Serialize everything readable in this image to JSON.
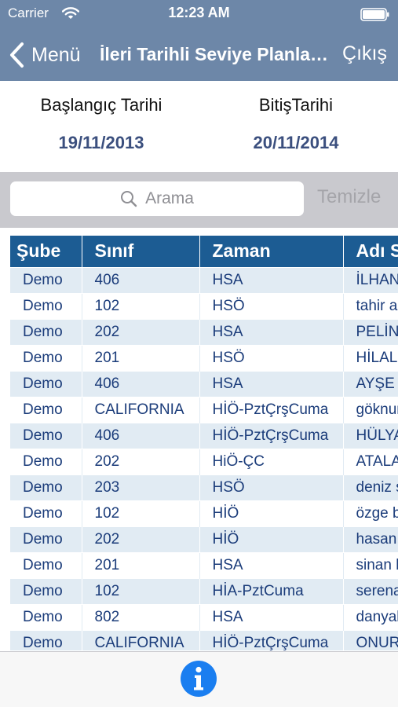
{
  "status_bar": {
    "carrier": "Carrier",
    "time": "12:23 AM"
  },
  "nav": {
    "back_label": "Menü",
    "title": "İleri Tarihli Seviye Planlaması",
    "exit_label": "Çıkış"
  },
  "dates": {
    "start_label": "Başlangıç Tarihi",
    "start_value": "19/11/2013",
    "end_label": "BitişTarihi",
    "end_value": "20/11/2014"
  },
  "search": {
    "placeholder": "Arama",
    "clear_label": "Temizle"
  },
  "table": {
    "headers": [
      "Şube",
      "Sınıf",
      "Zaman",
      "Adı Soyadı"
    ],
    "rows": [
      [
        "Demo",
        "406",
        "HSA",
        "İLHAN"
      ],
      [
        "Demo",
        "102",
        "HSÖ",
        "tahir a"
      ],
      [
        "Demo",
        "202",
        "HSA",
        "PELİN"
      ],
      [
        "Demo",
        "201",
        "HSÖ",
        "HİLAL"
      ],
      [
        "Demo",
        "406",
        "HSA",
        "AYŞE"
      ],
      [
        "Demo",
        "CALIFORNIA",
        "HİÖ-PztÇrşCuma",
        "göknur"
      ],
      [
        "Demo",
        "406",
        "HİÖ-PztÇrşCuma",
        "HÜLYA"
      ],
      [
        "Demo",
        "202",
        "HiÖ-ÇC",
        "ATALA"
      ],
      [
        "Demo",
        "203",
        "HSÖ",
        "deniz s"
      ],
      [
        "Demo",
        "102",
        "HİÖ",
        "özge b"
      ],
      [
        "Demo",
        "202",
        "HİÖ",
        "hasan"
      ],
      [
        "Demo",
        "201",
        "HSA",
        "sinan b"
      ],
      [
        "Demo",
        "102",
        "HİA-PztCuma",
        "serena"
      ],
      [
        "Demo",
        "802",
        "HSA",
        "danyal"
      ],
      [
        "Demo",
        "CALIFORNIA",
        "HİÖ-PztÇrşCuma",
        "ONUR"
      ]
    ]
  },
  "toolbar": {
    "info_icon": "info-icon"
  },
  "colors": {
    "header": "#6d87a8",
    "table_header": "#1c5c93",
    "row_alt": "#e1ebf3",
    "date_value": "#3b4f7e",
    "info": "#1a7ef0"
  }
}
